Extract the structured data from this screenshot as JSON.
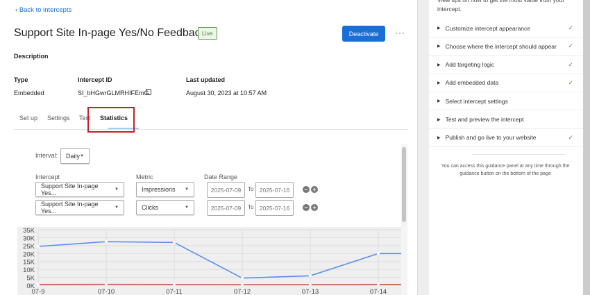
{
  "back_link": "Back to intercepts",
  "title": "Support Site In-page Yes/No Feedback",
  "status_badge": "Live",
  "deactivate_label": "Deactivate",
  "more_label": "···",
  "description_label": "Description",
  "details": {
    "type_label": "Type",
    "type_value": "Embedded",
    "id_label": "Intercept ID",
    "id_value": "SI_bHGwrGLMRHIFEmG",
    "updated_label": "Last updated",
    "updated_value": "August 30, 2023 at 10:57 AM"
  },
  "tabs": [
    "Set up",
    "Settings",
    "Test",
    "Statistics"
  ],
  "stats": {
    "interval_label": "Interval:",
    "interval_value": "Daily",
    "intercept_label": "Intercept",
    "metric_label": "Metric",
    "date_range_label": "Date Range",
    "to_label": "To",
    "rows": [
      {
        "intercept": "Support Site In-page Yes...",
        "metric": "Impressions",
        "from": "2025-07-09",
        "to": "2025-07-16"
      },
      {
        "intercept": "Support Site In-page Yes...",
        "metric": "Clicks",
        "from": "2025-07-09",
        "to": "2025-07-16"
      }
    ]
  },
  "chart_data": {
    "type": "line",
    "categories": [
      "07-9",
      "07-10",
      "07-11",
      "07-12",
      "07-13",
      "07-14"
    ],
    "y_ticks": [
      "35K",
      "30K",
      "25K",
      "20K",
      "15K",
      "10K",
      "5K",
      "0K"
    ],
    "ylim": [
      0,
      35000
    ],
    "series": [
      {
        "name": "Impressions",
        "color": "#5b8def",
        "values": [
          24500,
          27500,
          27000,
          4500,
          6000,
          20000
        ]
      },
      {
        "name": "Clicks",
        "color": "#d9534f",
        "values": [
          500,
          600,
          500,
          400,
          400,
          500
        ]
      }
    ]
  },
  "guidance": {
    "intro": "View tips on how to get the most value from your intercept.",
    "items": [
      {
        "label": "Customize intercept appearance",
        "done": true
      },
      {
        "label": "Choose where the intercept should appear",
        "done": true
      },
      {
        "label": "Add targeting logic",
        "done": true
      },
      {
        "label": "Add embedded data",
        "done": true
      },
      {
        "label": "Select intercept settings",
        "done": false
      },
      {
        "label": "Test and preview the intercept",
        "done": false
      },
      {
        "label": "Publish and go live to your website",
        "done": true
      }
    ],
    "note": "You can access this guidance panel at any time through the guidance button on the bottom of the page"
  }
}
